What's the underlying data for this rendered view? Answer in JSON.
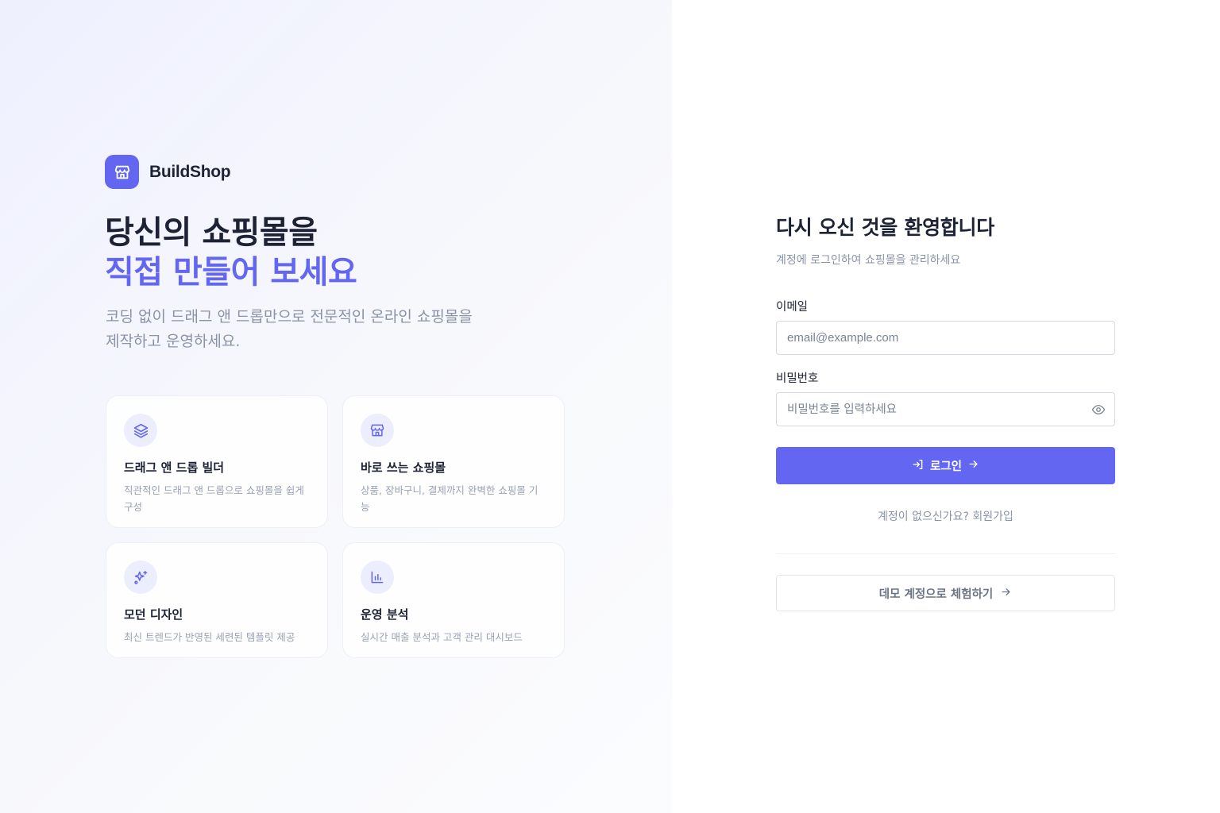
{
  "brand": {
    "name": "BuildShop",
    "icon": "store-icon",
    "color": "#6366f1"
  },
  "hero": {
    "title_line1": "당신의 쇼핑몰을",
    "title_line2": "직접 만들어 보세요",
    "description": "코딩 없이 드래그 앤 드롭만으로 전문적인 온라인 쇼핑몰을 제작하고 운영하세요."
  },
  "features": [
    {
      "icon": "layers-icon",
      "title": "드래그 앤 드롭 빌더",
      "desc": "직관적인 드래그 앤 드롭으로 쇼핑몰을 쉽게 구성"
    },
    {
      "icon": "store-icon",
      "title": "바로 쓰는 쇼핑몰",
      "desc": "상품, 장바구니, 결제까지 완벽한 쇼핑몰 기능"
    },
    {
      "icon": "sparkles-icon",
      "title": "모던 디자인",
      "desc": "최신 트렌드가 반영된 세련된 템플릿 제공"
    },
    {
      "icon": "bar-chart-icon",
      "title": "운영 분석",
      "desc": "실시간 매출 분석과 고객 관리 대시보드"
    }
  ],
  "login": {
    "title": "다시 오신 것을 환영합니다",
    "subtitle": "계정에 로그인하여 쇼핑몰을 관리하세요",
    "email_label": "이메일",
    "email_placeholder": "email@example.com",
    "password_label": "비밀번호",
    "password_placeholder": "비밀번호를 입력하세요",
    "submit_label": "로그인",
    "signup_prompt": "계정이 없으신가요?",
    "signup_link": "회원가입",
    "demo_label": "데모 계정으로 체험하기"
  }
}
